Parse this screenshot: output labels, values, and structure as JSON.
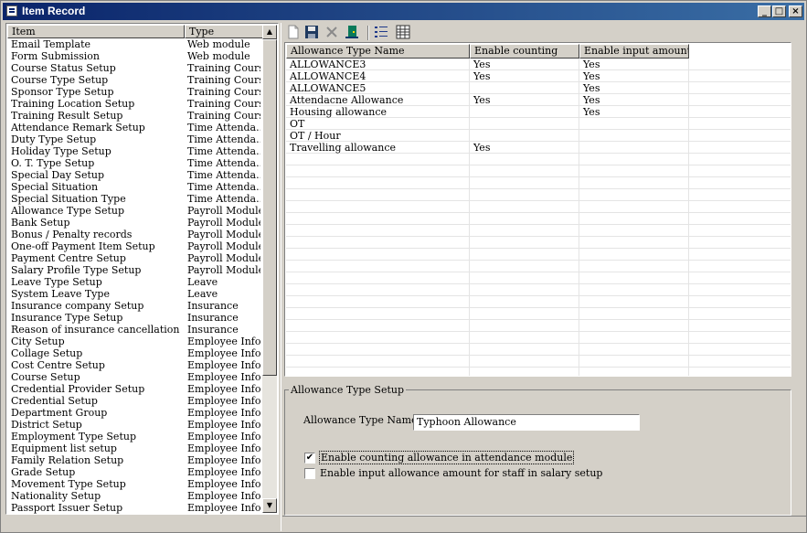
{
  "window": {
    "title": "Item Record"
  },
  "left_list": {
    "columns": [
      "Item",
      "Type"
    ],
    "rows": [
      [
        "Email Template",
        "Web module"
      ],
      [
        "Form Submission",
        "Web module"
      ],
      [
        "Course Status Setup",
        "Training Course"
      ],
      [
        "Course Type Setup",
        "Training Course"
      ],
      [
        "Sponsor Type Setup",
        "Training Course"
      ],
      [
        "Training Location Setup",
        "Training Course"
      ],
      [
        "Training Result Setup",
        "Training Course"
      ],
      [
        "Attendance Remark Setup",
        "Time Attenda..."
      ],
      [
        "Duty Type Setup",
        "Time Attenda..."
      ],
      [
        "Holiday Type Setup",
        "Time Attenda..."
      ],
      [
        "O. T. Type Setup",
        "Time Attenda..."
      ],
      [
        "Special Day Setup",
        "Time Attenda..."
      ],
      [
        "Special Situation",
        "Time Attenda..."
      ],
      [
        "Special Situation Type",
        "Time Attenda..."
      ],
      [
        "Allowance Type Setup",
        "Payroll Module"
      ],
      [
        "Bank Setup",
        "Payroll Module"
      ],
      [
        "Bonus / Penalty records",
        "Payroll Module"
      ],
      [
        "One-off Payment Item Setup",
        "Payroll Module"
      ],
      [
        "Payment Centre Setup",
        "Payroll Module"
      ],
      [
        "Salary Profile Type Setup",
        "Payroll Module"
      ],
      [
        "Leave Type Setup",
        "Leave"
      ],
      [
        "System Leave Type",
        "Leave"
      ],
      [
        "Insurance company Setup",
        "Insurance"
      ],
      [
        "Insurance Type Setup",
        "Insurance"
      ],
      [
        "Reason of insurance cancellation Setup",
        "Insurance"
      ],
      [
        "City Setup",
        "Employee Info."
      ],
      [
        "Collage Setup",
        "Employee Info."
      ],
      [
        "Cost Centre Setup",
        "Employee Info."
      ],
      [
        "Course Setup",
        "Employee Info."
      ],
      [
        "Credential Provider Setup",
        "Employee Info."
      ],
      [
        "Credential Setup",
        "Employee Info."
      ],
      [
        "Department Group",
        "Employee Info."
      ],
      [
        "District Setup",
        "Employee Info."
      ],
      [
        "Employment Type Setup",
        "Employee Info."
      ],
      [
        "Equipment list setup",
        "Employee Info."
      ],
      [
        "Family Relation Setup",
        "Employee Info."
      ],
      [
        "Grade Setup",
        "Employee Info."
      ],
      [
        "Movement Type Setup",
        "Employee Info."
      ],
      [
        "Nationality Setup",
        "Employee Info."
      ],
      [
        "Passport Issuer Setup",
        "Employee Info."
      ]
    ]
  },
  "toolbar": {
    "icons": [
      "new-icon",
      "save-icon",
      "delete-icon",
      "exit-icon",
      "list-view-icon",
      "grid-view-icon"
    ]
  },
  "grid": {
    "columns": [
      "Allowance Type Name",
      "Enable counting",
      "Enable input amount"
    ],
    "rows": [
      [
        "ALLOWANCE3",
        "Yes",
        "Yes"
      ],
      [
        "ALLOWANCE4",
        "Yes",
        "Yes"
      ],
      [
        "ALLOWANCE5",
        "",
        "Yes"
      ],
      [
        "Attendacne Allowance",
        "Yes",
        "Yes"
      ],
      [
        "Housing allowance",
        "",
        "Yes"
      ],
      [
        "OT",
        "",
        ""
      ],
      [
        "OT / Hour",
        "",
        ""
      ],
      [
        "Travelling allowance",
        "Yes",
        ""
      ]
    ]
  },
  "form": {
    "group_title": "Allowance Type Setup",
    "name_label": "Allowance Type Name",
    "name_value": "Typhoon Allowance",
    "checkbox1_label": "Enable counting allowance in attendance module",
    "checkbox1_checked": true,
    "checkbox2_label": "Enable input allowance amount for staff in salary setup",
    "checkbox2_checked": false
  }
}
